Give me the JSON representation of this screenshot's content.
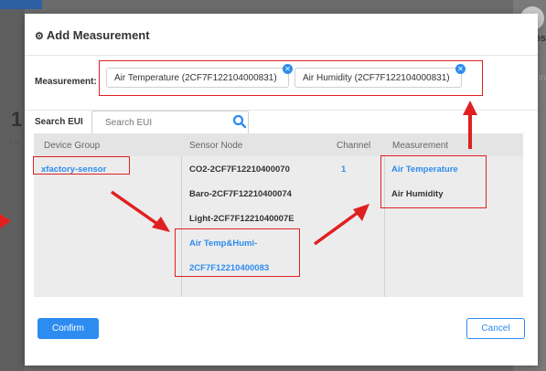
{
  "background": {
    "page_number": "1",
    "left_text": "Lo",
    "right_text_1": "es",
    "right_text_2": "con"
  },
  "modal": {
    "title": "Add Measurement",
    "measurement_label": "Measurement:",
    "selected_tags": [
      {
        "label": "Air Temperature (2CF7F122104000831)"
      },
      {
        "label": "Air Humidity (2CF7F122104000831)"
      }
    ],
    "search": {
      "label": "Search EUI",
      "placeholder": "Search EUI"
    },
    "table": {
      "headers": {
        "device_group": "Device Group",
        "sensor_node": "Sensor Node",
        "channel": "Channel",
        "measurement": "Measurement"
      },
      "device_groups": [
        "xfactory-sensor"
      ],
      "sensor_nodes": [
        "CO2-2CF7F12210400070",
        "Baro-2CF7F12210400074",
        "Light-2CF7F1221040007E",
        "Air Temp&Humi-",
        "2CF7F12210400083"
      ],
      "channels": [
        "1"
      ],
      "measurements": [
        "Air Temperature",
        "Air Humidity"
      ]
    },
    "confirm_label": "Confirm",
    "cancel_label": "Cancel"
  },
  "colors": {
    "accent": "#2d8cf0",
    "annotation": "#e02020",
    "backdrop": "#6b6b6b"
  },
  "icons": [
    "gear-icon",
    "close-icon",
    "search-icon",
    "tag-remove-icon",
    "arrow-icon"
  ]
}
